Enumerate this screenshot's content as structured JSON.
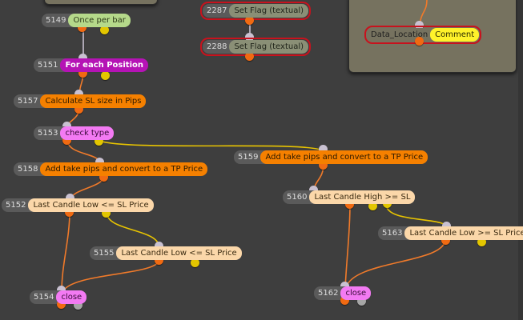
{
  "nodes": {
    "n5149": {
      "id": "5149",
      "label": "Once per bar"
    },
    "n5151": {
      "id": "5151",
      "label": "For each Position"
    },
    "n5157": {
      "id": "5157",
      "label": "Calculate SL size in Pips"
    },
    "n5153": {
      "id": "5153",
      "label": "check type"
    },
    "n5158": {
      "id": "5158",
      "label": "Add take pips and convert to a TP Price"
    },
    "n5152": {
      "id": "5152",
      "label": "Last Candle Low <= SL Price"
    },
    "n5155": {
      "id": "5155",
      "label": "Last Candle Low <= SL Price"
    },
    "n5154": {
      "id": "5154",
      "label": "close"
    },
    "n2287": {
      "id": "2287",
      "label": "Set Flag (textual)"
    },
    "n2288": {
      "id": "2288",
      "label": "Set Flag (textual)"
    },
    "n5159": {
      "id": "5159",
      "label": "Add take pips and convert to a TP Price"
    },
    "n5160": {
      "id": "5160",
      "label": "Last Candle High >= SL"
    },
    "n5163": {
      "id": "5163",
      "label": "Last Candle Low >= SL Price"
    },
    "n5162": {
      "id": "5162",
      "label": "close"
    },
    "ndata": {
      "id": "Data_Location",
      "label": "Comment"
    }
  },
  "colors": {
    "canvas": "#3e3e3e",
    "panel": "#76725f",
    "wire_orange": "#f07a2a",
    "wire_yellow": "#e8c400",
    "flag_border": "#c8121d"
  }
}
